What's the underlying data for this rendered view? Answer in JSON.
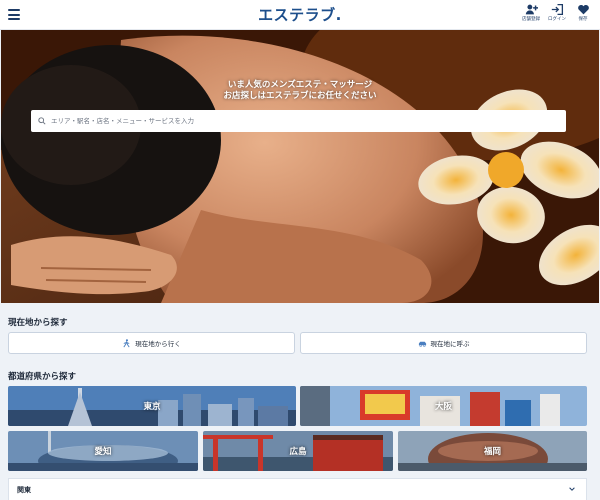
{
  "header": {
    "logo_text": "エステラブ.",
    "actions": [
      {
        "label": "店舗登録",
        "icon": "add-user-icon"
      },
      {
        "label": "ログイン",
        "icon": "login-icon"
      },
      {
        "label": "保存",
        "icon": "heart-icon"
      }
    ]
  },
  "hero": {
    "tagline_line1": "いま人気のメンズエステ・マッサージ",
    "tagline_line2": "お店探しはエステラブにお任せください",
    "search_placeholder": "エリア・駅名・店名・メニュー・サービスを入力"
  },
  "location_section": {
    "title": "現在地から探す",
    "go_button": "現在地から行く",
    "call_button": "現在地に呼ぶ"
  },
  "prefecture_section": {
    "title": "都道府県から探す",
    "prefectures": [
      {
        "name": "東京"
      },
      {
        "name": "大阪"
      },
      {
        "name": "愛知"
      },
      {
        "name": "広島"
      },
      {
        "name": "福岡"
      }
    ]
  },
  "regions": [
    {
      "name": "関東"
    }
  ],
  "colors": {
    "brand": "#1d4f8c",
    "page_bg": "#eef2f7",
    "button_border": "#c9d3e0"
  }
}
